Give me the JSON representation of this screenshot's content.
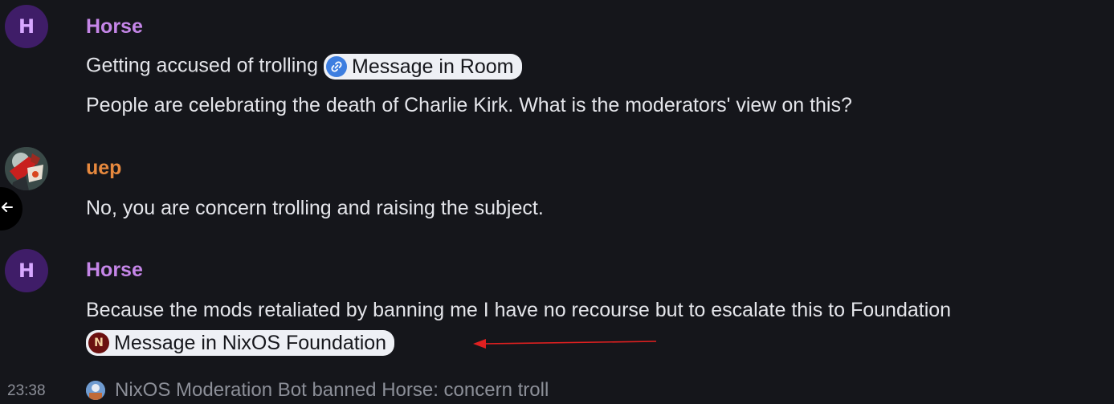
{
  "messages": [
    {
      "sender": "Horse",
      "avatar_letter": "H",
      "lines": [
        {
          "text": "Getting accused of trolling",
          "pill": "Message in Room"
        },
        {
          "text": "People are celebrating the death of Charlie Kirk. What is the moderators' view on this?"
        }
      ]
    },
    {
      "sender": "uep",
      "lines": [
        {
          "text": "No, you are concern trolling and raising the subject."
        }
      ]
    },
    {
      "sender": "Horse",
      "avatar_letter": "H",
      "lines": [
        {
          "text": "Because the mods retaliated by banning me I have no recourse but to escalate this to Foundation"
        },
        {
          "pill": "Message in NixOS Foundation",
          "pill_icon_letter": "N"
        }
      ]
    }
  ],
  "event": {
    "timestamp": "23:38",
    "text": "NixOS Moderation Bot banned Horse: concern troll"
  },
  "icons": {
    "back": "arrow-left-icon",
    "link": "link-icon"
  },
  "colors": {
    "background": "#15161b",
    "horse_name": "#c586e8",
    "uep_name": "#e7893e",
    "annotation_arrow": "#e02020"
  }
}
